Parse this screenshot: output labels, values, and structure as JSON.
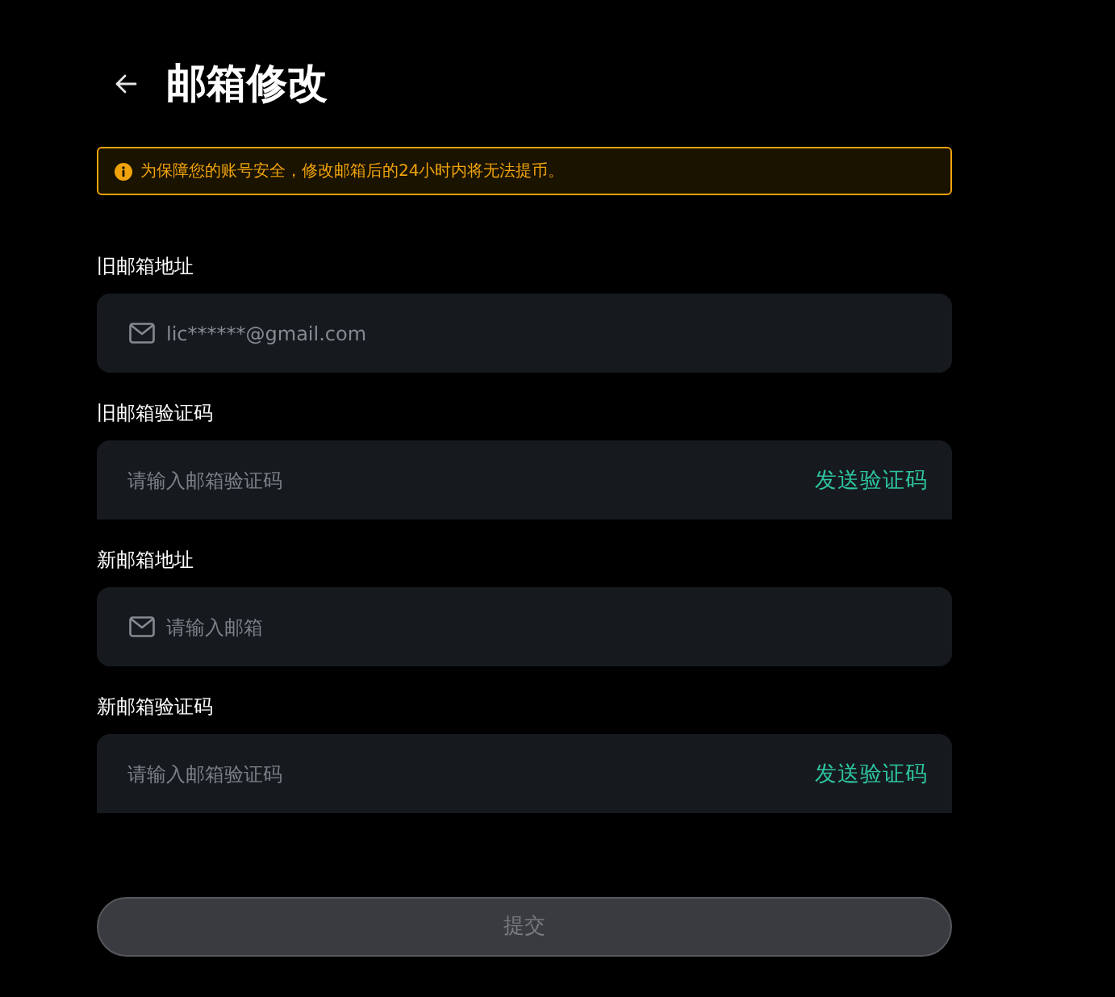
{
  "header": {
    "title": "邮箱修改"
  },
  "notice": {
    "text": "为保障您的账号安全，修改邮箱后的24小时内将无法提币。"
  },
  "fields": [
    {
      "kind": "email",
      "label": "旧邮箱地址",
      "value": "lic******@gmail.com",
      "disabled": true
    },
    {
      "kind": "code",
      "label": "旧邮箱验证码",
      "placeholder": "请输入邮箱验证码",
      "action": "发送验证码",
      "disabled": false
    },
    {
      "kind": "email",
      "label": "新邮箱地址",
      "placeholder": "请输入邮箱",
      "disabled": false
    },
    {
      "kind": "code",
      "label": "新邮箱验证码",
      "placeholder": "请输入邮箱验证码",
      "action": "发送验证码",
      "disabled": false
    }
  ],
  "submit": {
    "label": "提交",
    "disabled": true
  }
}
